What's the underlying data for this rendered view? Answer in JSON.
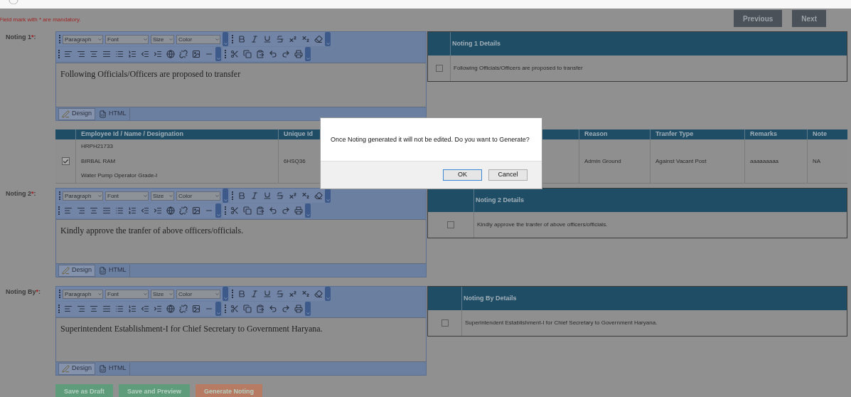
{
  "notice": "Field mark with * are mandatory.",
  "nav_buttons": [
    {
      "label": "Previous"
    },
    {
      "label": "Next"
    }
  ],
  "sections": [
    {
      "label": "Noting 1",
      "required_mark": "*",
      "colon": ":",
      "editor": {
        "dropdowns": [
          "Paragraph",
          "Font",
          "Size",
          "Color"
        ],
        "content": "Following Officials/Officers are proposed to transfer",
        "modes": [
          {
            "label": "Design",
            "selected": true
          },
          {
            "label": "HTML",
            "selected": false
          }
        ]
      },
      "details": {
        "title": "Noting 1 Details",
        "rows": [
          {
            "checked": false,
            "text": "Following Officials/Officers are proposed to transfer"
          }
        ]
      }
    },
    {
      "label": "Noting 2",
      "required_mark": "*",
      "colon": ":",
      "editor": {
        "dropdowns": [
          "Paragraph",
          "Font",
          "Size",
          "Color"
        ],
        "content": "Kindly approve the tranfer of above officers/officials.",
        "modes": [
          {
            "label": "Design",
            "selected": true
          },
          {
            "label": "HTML",
            "selected": false
          }
        ]
      },
      "details": {
        "title": "Noting 2 Details",
        "rows": [
          {
            "checked": false,
            "text": "Kindly approve the tranfer of above officers/officials."
          }
        ]
      }
    },
    {
      "label": "Noting By",
      "required_mark": "*",
      "colon": ":",
      "editor": {
        "dropdowns": [
          "Paragraph",
          "Font",
          "Size",
          "Color"
        ],
        "content": "Superintendent Establishment-I for Chief Secretary to Government Haryana.",
        "modes": [
          {
            "label": "Design",
            "selected": true
          },
          {
            "label": "HTML",
            "selected": false
          }
        ]
      },
      "details": {
        "title": "Noting By Details",
        "rows": [
          {
            "checked": false,
            "text": "Superintendent Establishment-I for Chief Secretary to Government Haryana."
          }
        ]
      }
    }
  ],
  "employee_table": {
    "columns": [
      "Employee Id / Name / Designation",
      "Unique Id",
      "Reason",
      "Tranfer Type",
      "Remarks",
      "Note"
    ],
    "rows": [
      {
        "selected": true,
        "employee": [
          "HRPH21733",
          "BIRBAL RAM",
          "Water Pump Operator Grade-I"
        ],
        "unique_id": "6HSQ36",
        "reason": "Admin Ground",
        "transfer_type": "Against Vacant Post",
        "remarks": "aaaaaaaaa",
        "note": "NA"
      }
    ]
  },
  "action_buttons": [
    {
      "label": "Save as Draft",
      "kind": "draft"
    },
    {
      "label": "Save and Preview",
      "kind": "preview"
    },
    {
      "label": "Generate Noting",
      "kind": "generate"
    }
  ],
  "dialog": {
    "message": "Once Noting generated it will not be edited. Do you want to Generate?",
    "buttons": [
      {
        "label": "OK",
        "selected": true
      },
      {
        "label": "Cancel",
        "selected": false
      }
    ]
  }
}
